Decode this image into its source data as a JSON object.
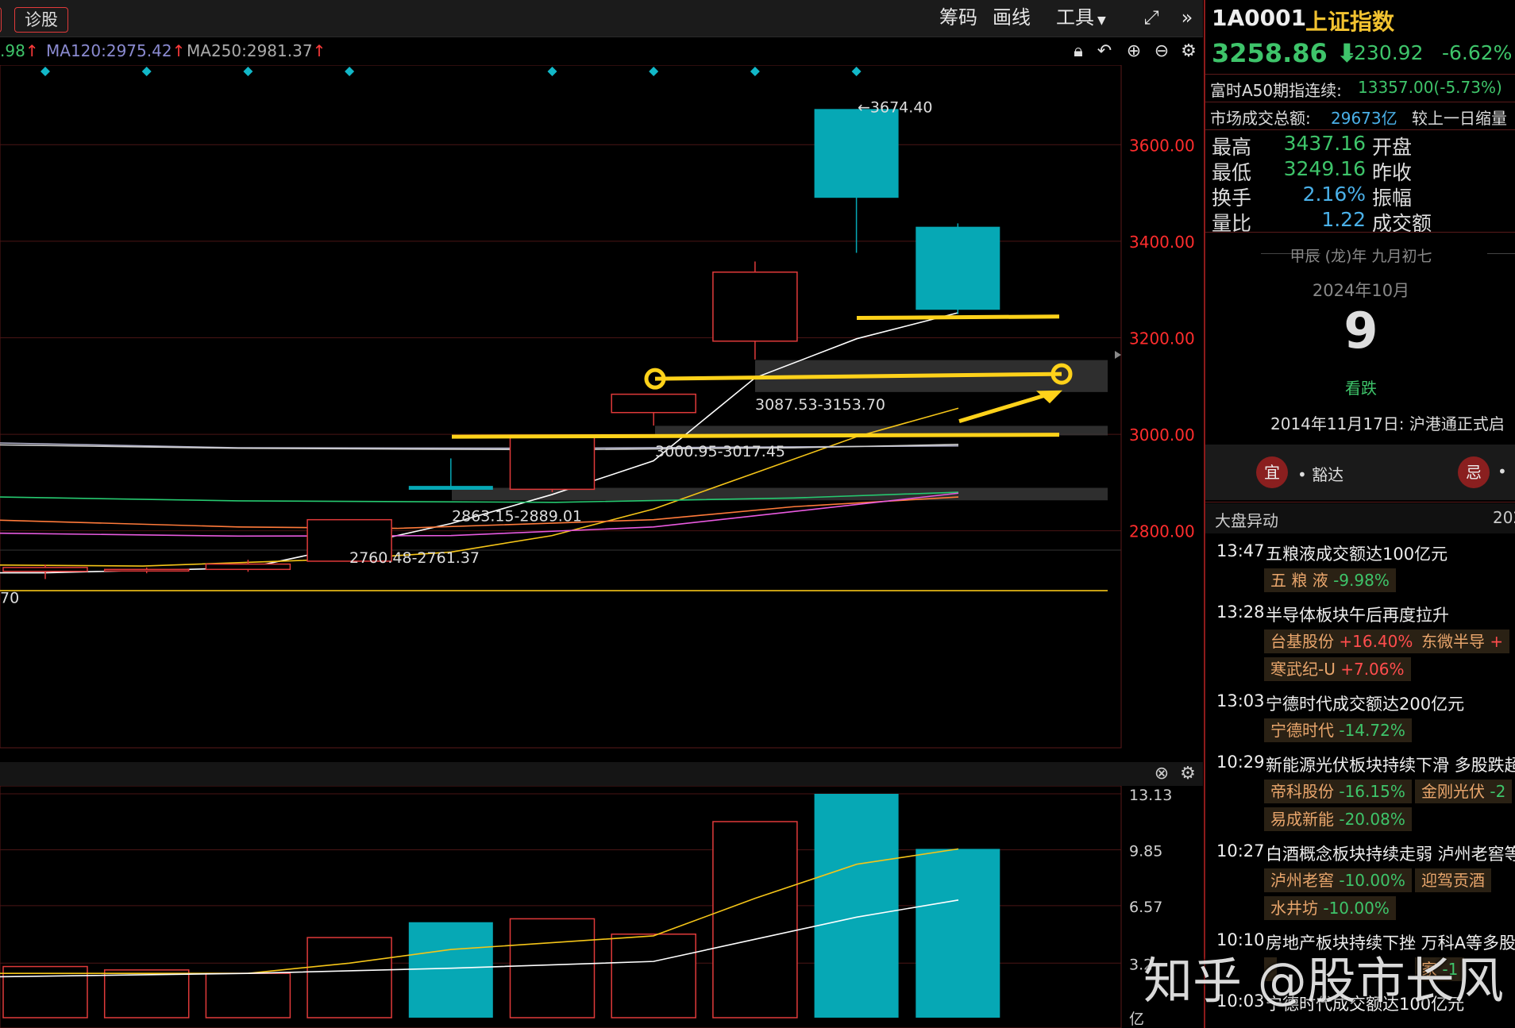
{
  "toolbar": {
    "diag_label": "诊股",
    "chouma": "筹码",
    "huaxian": "画线",
    "gongju": "工具",
    "expand_icon": "expand-icon",
    "more_icon": "double-chevron-icon"
  },
  "ma_bar": {
    "ma_partial": ".98",
    "ma120": "MA120:2975.42",
    "ma250": "MA250:2981.37",
    "colors": {
      "ma_partial": "#3ec46a",
      "ma120": "#8a8ad0",
      "ma250": "#aaaaaa"
    }
  },
  "chart_tools": [
    "lock-icon",
    "undo-icon",
    "zoom-in-icon",
    "zoom-out-icon",
    "gear-icon"
  ],
  "chart_data": {
    "type": "candlestick",
    "y_axis_labels": [
      "3600.00",
      "3400.00",
      "3200.00",
      "3000.00",
      "2800.00"
    ],
    "ylim": [
      2630,
      3765
    ],
    "candles": [
      {
        "open": 2724,
        "close": 2716,
        "high": 2730,
        "low": 2700,
        "dir": "up"
      },
      {
        "open": 2717,
        "close": 2720,
        "high": 2724,
        "low": 2712,
        "dir": "up"
      },
      {
        "open": 2720,
        "close": 2731,
        "high": 2740,
        "low": 2715,
        "dir": "up"
      },
      {
        "open": 2737,
        "close": 2823,
        "high": 2823,
        "low": 2737,
        "dir": "up"
      },
      {
        "open": 2893,
        "close": 2885,
        "high": 2950,
        "low": 2885,
        "dir": "down"
      },
      {
        "open": 2886,
        "close": 2997,
        "high": 2997,
        "low": 2880,
        "dir": "up"
      },
      {
        "open": 3045,
        "close": 3083,
        "high": 3083,
        "low": 3018,
        "dir": "up"
      },
      {
        "open": 3193,
        "close": 3336,
        "high": 3358,
        "low": 3155,
        "dir": "up"
      },
      {
        "open": 3674,
        "close": 3490,
        "high": 3674,
        "low": 3376,
        "dir": "down"
      },
      {
        "open": 3430,
        "close": 3258,
        "high": 3437,
        "low": 3249,
        "dir": "down"
      }
    ],
    "annotations": [
      {
        "text": "←3674.40"
      },
      {
        "text": "3087.53-3153.70"
      },
      {
        "text": "3000.95-3017.45"
      },
      {
        "text": "2863.15-2889.01"
      },
      {
        "text": "2760.48-2761.37"
      },
      {
        "text": "70"
      }
    ],
    "gap_zones": [
      [
        3087.53,
        3153.7
      ],
      [
        3000.95,
        3017.45
      ],
      [
        2863.15,
        2889.01
      ]
    ],
    "volume": {
      "y_axis_labels": [
        "13.13",
        "9.85",
        "6.57",
        "3.2"
      ],
      "unit": "亿",
      "ylim": [
        0,
        13.13
      ],
      "values": [
        3.0,
        2.8,
        2.6,
        4.7,
        5.6,
        5.8,
        4.9,
        11.5,
        13.13,
        9.9
      ],
      "dirs": [
        "up",
        "up",
        "up",
        "up",
        "down",
        "up",
        "up",
        "up",
        "down",
        "down"
      ]
    },
    "colors": {
      "up": "#e03a3a",
      "down": "#06a8b5",
      "grid": "#4a1515",
      "axis": "#ff2d2d",
      "yellow": "#ffd21a"
    }
  },
  "panel": {
    "code": "1A0001",
    "name": "上证指数",
    "price": "3258.86",
    "change": "-230.92",
    "pct": "-6.62%",
    "a50_label": "富时A50期指连续:",
    "a50_val": "13357.00(-5.73%)",
    "turnover_label": "市场成交总额:",
    "turnover_val": "29673亿",
    "turnover_cmp": "较上一日缩量",
    "stats": [
      {
        "label": "最高",
        "value": "3437.16",
        "label2": "开盘"
      },
      {
        "label": "最低",
        "value": "3249.16",
        "label2": "昨收"
      },
      {
        "label": "换手",
        "value": "2.16%",
        "label2": "振幅"
      },
      {
        "label": "量比",
        "value": "1.22",
        "label2": "成交额"
      }
    ],
    "lunar": "甲辰 (龙)年 九月初七",
    "month": "2024年10月",
    "day": "9",
    "mood": "看跌",
    "history": "2014年11月17日: 沪港通正式启",
    "yi_label": "宜",
    "yi_text": "豁达",
    "ji_label": "忌",
    "section_title": "大盘异动",
    "section_year": "202",
    "news": [
      {
        "time": "13:47",
        "title": "五粮液成交额达100亿元",
        "chips": [
          {
            "name": "五 粮 液",
            "pct": "-9.98%",
            "dir": "dn"
          }
        ]
      },
      {
        "time": "13:28",
        "title": "半导体板块午后再度拉升",
        "chips": [
          {
            "name": "台基股份",
            "pct": "+16.40%",
            "dir": "up"
          },
          {
            "name": "东微半导",
            "pct": "+",
            "dir": "up"
          },
          {
            "name": "寒武纪-U",
            "pct": "+7.06%",
            "dir": "up"
          }
        ]
      },
      {
        "time": "13:03",
        "title": "宁德时代成交额达200亿元",
        "chips": [
          {
            "name": "宁德时代",
            "pct": "-14.72%",
            "dir": "dn"
          }
        ]
      },
      {
        "time": "10:29",
        "title": "新能源光伏板块持续下滑 多股跌超",
        "chips": [
          {
            "name": "帝科股份",
            "pct": "-16.15%",
            "dir": "dn"
          },
          {
            "name": "金刚光伏",
            "pct": "-2",
            "dir": "dn"
          },
          {
            "name": "易成新能",
            "pct": "-20.08%",
            "dir": "dn"
          }
        ]
      },
      {
        "time": "10:27",
        "title": "白酒概念板块持续走弱 泸州老窖等",
        "chips": [
          {
            "name": "泸州老窖",
            "pct": "-10.00%",
            "dir": "dn"
          },
          {
            "name": "迎驾贡酒",
            "pct": "",
            "dir": "dn"
          },
          {
            "name": "水井坊",
            "pct": "-10.00%",
            "dir": "dn"
          }
        ]
      },
      {
        "time": "10:10",
        "title": "房地产板块持续下挫 万科A等多股",
        "chips": [
          {
            "name": "",
            "pct": "",
            "dir": "dn"
          },
          {
            "name": "家",
            "pct": "-1",
            "dir": "dn"
          }
        ]
      },
      {
        "time": "10:03",
        "title": "宁德时代成交额达100亿元",
        "chips": []
      }
    ]
  },
  "watermark": "知乎 @股市长风"
}
